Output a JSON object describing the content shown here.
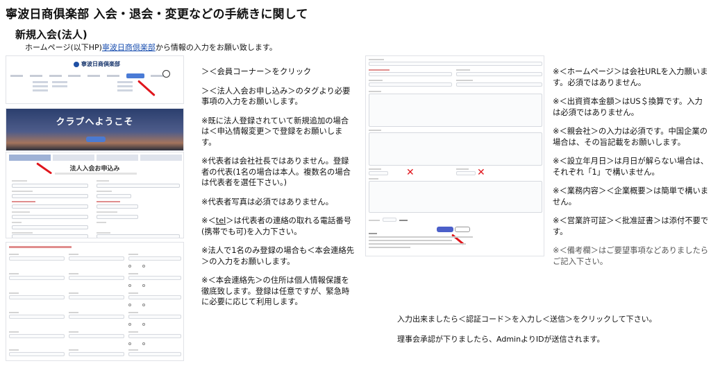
{
  "page": {
    "title": "寧波日商俱楽部 入会・退会・変更などの手続きに関して",
    "section_title": "新規入会(法人)",
    "intro_prefix": "ホームページ(以下HP)",
    "intro_link": "寧波日商倶楽部",
    "intro_suffix": "から情報の入力をお願い致します。"
  },
  "screenshots": {
    "site_name": "寧波日商倶楽部",
    "banner_title": "クラブへようこそ",
    "form_heading": "法人入会お申込み"
  },
  "instructions_middle": [
    "＞＜会員コーナー＞をクリック",
    "＞＜法人入会お申し込み＞のタグより必要事項の入力をお願いします。",
    "※既に法人登録されていて新規追加の場合は＜申込情報変更＞で登録をお願いします。",
    "※代表者は会社社長ではありません。登録者の代表(1名の場合は本人。複数名の場合は代表者を選任下さい。)",
    "※代表者写真は必須ではありません。",
    "※法人で1名のみ登録の場合も＜本会連絡先＞の入力をお願いします。",
    "※＜本会連絡先＞の住所は個人情報保護を徹底致します。登録は任意ですが、緊急時に必要に応じて利用します。"
  ],
  "tel_note": {
    "prefix": "※＜",
    "link": "tel",
    "suffix": "＞は代表者の連絡の取れる電話番号(携帯でも可)を入力下さい。"
  },
  "instructions_right": [
    "※＜ホームページ＞は会社URLを入力願います。必須ではありません。",
    "※＜出資資本金額＞はUS＄換算です。入力は必須ではありません。",
    "※＜親会社＞の入力は必須です。中国企業の場合は、その旨記載をお願いします。",
    "※＜設立年月日＞は月日が解らない場合は、それぞれ「1」で構いません。",
    "※＜業務内容＞＜企業概要＞は簡単で構いません。",
    "※＜営業許可証＞＜批准証書＞は添付不要です。",
    "※＜備考欄＞はご要望事項などありましたらご記入下さい。"
  ],
  "footer": {
    "line1": "入力出来ましたら＜認証コード＞を入力し＜送信＞をクリックして下さい。",
    "line2": "理事会承認が下りましたら、AdminよりIDが送信されます。"
  },
  "colors": {
    "accent_red": "#e0151c",
    "link_blue": "#1a4fb0",
    "note_gray": "#555555"
  }
}
